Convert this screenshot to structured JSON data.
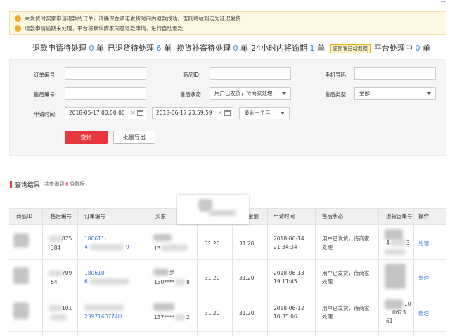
{
  "topbar": {
    "link_text": "…"
  },
  "notice": {
    "lines": [
      "未发货时买家申请退款的订单，请确保在承诺发货时间内退款成功。否则将被判定为延迟发货",
      "退款申请逾期未处理，平台将默认商家同意退款申请，进行自动退款"
    ]
  },
  "stats": [
    {
      "label": "退款申请待处理",
      "count": "0",
      "unit": "单"
    },
    {
      "label": "已退货待处理",
      "count": "6",
      "unit": "单"
    },
    {
      "label": "换货补寄待处理",
      "count": "0",
      "unit": "单"
    },
    {
      "label": "24小时内将逾期",
      "count": "1",
      "unit": "单",
      "badge": "逾期将自动退款"
    },
    {
      "label": "平台处理中",
      "count": "0",
      "unit": "单"
    }
  ],
  "filters": {
    "order_no_label": "订单编号:",
    "product_id_label": "商品ID:",
    "phone_label": "手机号码:",
    "after_sale_no_label": "售后编号:",
    "after_sale_status_label": "售后状态:",
    "after_sale_status_value": "用户已发货，待商家处理",
    "after_sale_type_label": "售后类型:",
    "after_sale_type_value": "全部",
    "apply_time_label": "申请时间:",
    "date_start": "2018-05-17 00:00:00",
    "date_end": "2018-06-17 23:59:59",
    "range_value": "最近一个月",
    "query_button": "查询",
    "export_button": "批量导出"
  },
  "results": {
    "title": "查询结果",
    "count_prefix": "共查询到",
    "count": "6",
    "count_suffix": "条数据"
  },
  "table": {
    "headers": [
      "商品ID",
      "售后编号",
      "订单编号",
      "买家",
      "",
      "金额",
      "申请时间",
      "售后状态",
      "退货运单号",
      "操作"
    ],
    "rows": [
      {
        "after_sale_no_a": "875",
        "after_sale_no_b": "384",
        "order_no_a": "180611-",
        "order_no_b": "4",
        "order_no_c": "9",
        "buyer_a": "",
        "buyer_b": "13",
        "price": "31.20",
        "amount": "31.20",
        "apply_date": "2018-06-14",
        "apply_time": "21:34:34",
        "status_a": "用户已发货，待商家",
        "status_b": "处理",
        "waybill_a": "4",
        "waybill_b": "3",
        "action": "处理"
      },
      {
        "after_sale_no_a": "709",
        "after_sale_no_b": "64",
        "order_no_a": "180610-",
        "order_no_b": "6",
        "order_no_c": "",
        "buyer_a": "步",
        "buyer_b": "130****",
        "buyer_c": "8",
        "price": "31.20",
        "amount": "31.20",
        "apply_date": "2018-06-13",
        "apply_time": "19:11:45",
        "status_a": "用户已发货，待商家",
        "status_b": "处理",
        "waybill_a": "",
        "waybill_b": "",
        "action": "处理"
      },
      {
        "after_sale_no_a": "101",
        "after_sale_no_b": "",
        "order_no_a": "",
        "order_no_b": "2397160774U",
        "order_no_c": "",
        "buyer_a": "",
        "buyer_b": "137****",
        "buyer_c": "2",
        "price": "31.20",
        "amount": "31.20",
        "apply_date": "2018-06-12",
        "apply_time": "10:35:06",
        "status_a": "用户已发货，待商家",
        "status_b": "处理",
        "waybill_a": "10",
        "waybill_b": "0623",
        "waybill_c": "61",
        "action": "处理"
      }
    ]
  },
  "colors": {
    "accent_red": "#e6383c",
    "link_blue": "#3a7bd5",
    "notice_bg": "#fff8e0",
    "warning_icon": "#f5a623"
  }
}
